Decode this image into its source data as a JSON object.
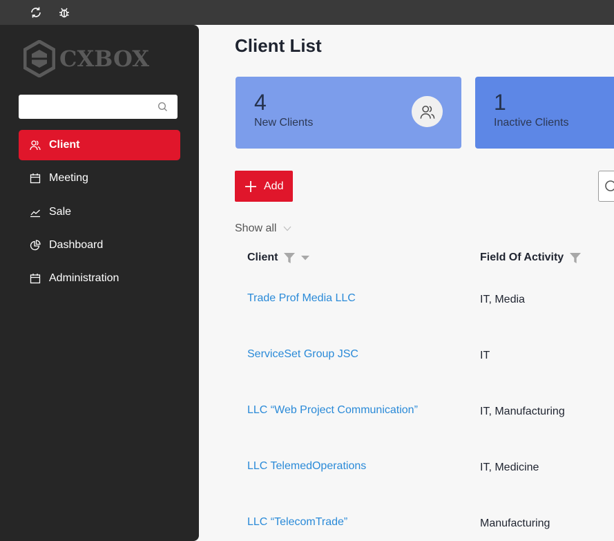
{
  "topbar": {
    "icons": [
      "refresh-icon",
      "bug-icon"
    ]
  },
  "sidebar": {
    "logo_text": "CXBOX",
    "search": {
      "value": "",
      "placeholder": ""
    },
    "items": [
      {
        "label": "Client",
        "icon": "users-icon",
        "active": true
      },
      {
        "label": "Meeting",
        "icon": "calendar-icon",
        "active": false
      },
      {
        "label": "Sale",
        "icon": "chart-line-icon",
        "active": false
      },
      {
        "label": "Dashboard",
        "icon": "pie-chart-icon",
        "active": false
      },
      {
        "label": "Administration",
        "icon": "calendar-icon",
        "active": false
      }
    ]
  },
  "main": {
    "title": "Client List",
    "cards": [
      {
        "value": "4",
        "label": "New Clients",
        "icon": "users-icon"
      },
      {
        "value": "1",
        "label": "Inactive Clients"
      }
    ],
    "add_label": "Add",
    "filter_label": "Show all",
    "table": {
      "columns": [
        "Client",
        "Field Of Activity"
      ],
      "rows": [
        {
          "client": "Trade Prof Media LLC",
          "field": "IT, Media"
        },
        {
          "client": "ServiceSet Group JSC",
          "field": "IT"
        },
        {
          "client": "LLC “Web Project Communication”",
          "field": "IT, Manufacturing"
        },
        {
          "client": "LLC TelemedOperations",
          "field": "IT, Medicine"
        },
        {
          "client": "LLC “TelecomTrade”",
          "field": "Manufacturing"
        }
      ]
    }
  },
  "colors": {
    "accent": "#e0162b",
    "sidebar_bg": "#262626",
    "card1_bg": "#7c9deb",
    "card2_bg": "#5d87e6",
    "link": "#2a8ad8"
  }
}
